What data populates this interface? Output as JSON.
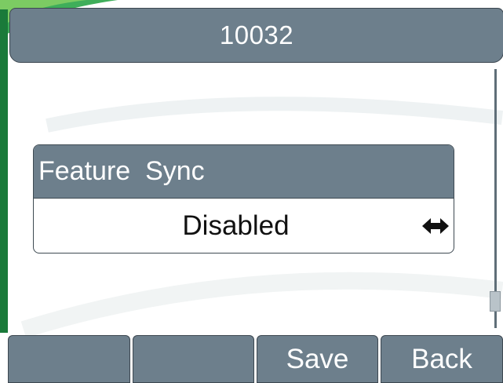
{
  "header": {
    "title": "10032"
  },
  "setting": {
    "label": "Feature  Sync",
    "value": "Disabled",
    "toggle_icon": "left-right-arrows-icon"
  },
  "softkeys": [
    {
      "label": ""
    },
    {
      "label": ""
    },
    {
      "label": "Save"
    },
    {
      "label": "Back"
    }
  ],
  "colors": {
    "bar": "#6d7f8c",
    "accent_green": "#1a7a3a",
    "background": "#ffffff"
  }
}
